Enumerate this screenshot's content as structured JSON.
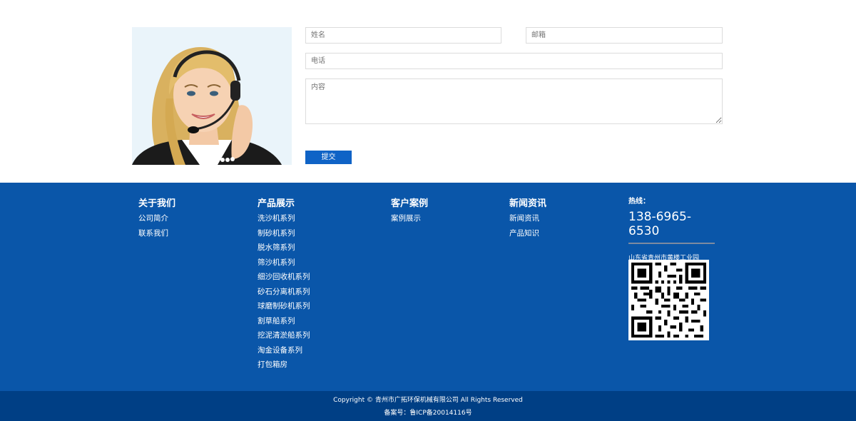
{
  "form": {
    "name_placeholder": "姓名",
    "email_placeholder": "邮箱",
    "phone_placeholder": "电话",
    "content_placeholder": "内容",
    "submit_label": "提交"
  },
  "footer": {
    "about": {
      "title": "关于我们",
      "links": [
        "公司简介",
        "联系我们"
      ]
    },
    "products": {
      "title": "产品展示",
      "links": [
        "洗沙机系列",
        "制砂机系列",
        "脱水筛系列",
        "筛沙机系列",
        "细沙回收机系列",
        "砂石分离机系列",
        "球磨制砂机系列",
        "割草船系列",
        "挖泥清淤船系列",
        "淘金设备系列",
        "打包箱房"
      ]
    },
    "cases": {
      "title": "客户案例",
      "links": [
        "案例展示"
      ]
    },
    "news": {
      "title": "新闻资讯",
      "links": [
        "新闻资讯",
        "产品知识"
      ]
    },
    "hotline_label": "热线：",
    "hotline_number": "138-6965-6530",
    "address": "山东省青州市黄楼工业园"
  },
  "bottom": {
    "copyright": "Copyright © 青州市广拓环保机械有限公司 All Rights Reserved",
    "icp": "备案号：鲁ICP备20014116号"
  },
  "colors": {
    "footer_bg": "#0a56a9",
    "bottom_bg": "#003f85",
    "button_bg": "#0f63c6"
  },
  "icons": {
    "photo": "customer-service-photo",
    "qr": "qr-code"
  }
}
